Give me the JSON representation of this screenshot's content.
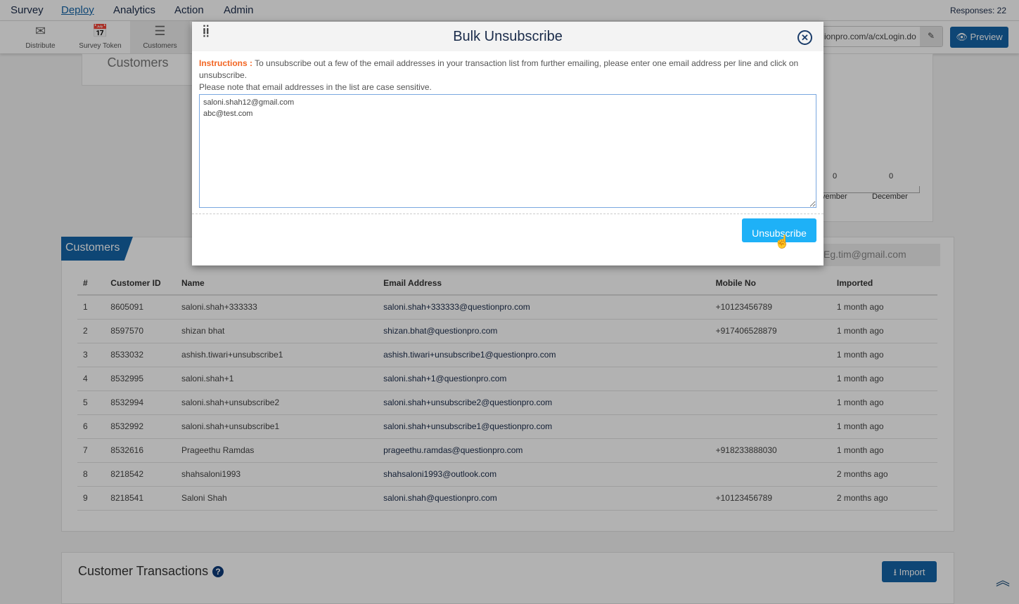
{
  "topnav": {
    "items": [
      "Survey",
      "Deploy",
      "Analytics",
      "Action",
      "Admin"
    ],
    "active": "Deploy",
    "responses": "Responses: 22"
  },
  "subnav": [
    {
      "label": "Distribute",
      "icon": "distribute-icon"
    },
    {
      "label": "Survey Token",
      "icon": "calendar-clock-icon"
    },
    {
      "label": "Customers",
      "icon": "customers-list-icon"
    }
  ],
  "url": "ionpro.com/a/cxLogin.do",
  "preview_label": "Preview",
  "customers_header": "Customers",
  "chart": {
    "values": [
      "0",
      "0"
    ],
    "labels": [
      "vember",
      "December"
    ]
  },
  "customers_tab": "Customers",
  "search_placeholder": "Eg.tim@gmail.com",
  "table": {
    "headers": [
      "#",
      "Customer ID",
      "Name",
      "Email Address",
      "Mobile No",
      "Imported"
    ],
    "rows": [
      [
        "1",
        "8605091",
        "saloni.shah+333333",
        "saloni.shah+333333@questionpro.com",
        "+10123456789",
        "1 month ago"
      ],
      [
        "2",
        "8597570",
        "shizan bhat",
        "shizan.bhat@questionpro.com",
        "+917406528879",
        "1 month ago"
      ],
      [
        "3",
        "8533032",
        "ashish.tiwari+unsubscribe1",
        "ashish.tiwari+unsubscribe1@questionpro.com",
        "",
        "1 month ago"
      ],
      [
        "4",
        "8532995",
        "saloni.shah+1",
        "saloni.shah+1@questionpro.com",
        "",
        "1 month ago"
      ],
      [
        "5",
        "8532994",
        "saloni.shah+unsubscribe2",
        "saloni.shah+unsubscribe2@questionpro.com",
        "",
        "1 month ago"
      ],
      [
        "6",
        "8532992",
        "saloni.shah+unsubscribe1",
        "saloni.shah+unsubscribe1@questionpro.com",
        "",
        "1 month ago"
      ],
      [
        "7",
        "8532616",
        "Prageethu Ramdas",
        "prageethu.ramdas@questionpro.com",
        "+918233888030",
        "1 month ago"
      ],
      [
        "8",
        "8218542",
        "shahsaloni1993",
        "shahsaloni1993@outlook.com",
        "",
        "2 months ago"
      ],
      [
        "9",
        "8218541",
        "Saloni Shah",
        "saloni.shah@questionpro.com",
        "+10123456789",
        "2 months ago"
      ]
    ]
  },
  "transactions": {
    "title": "Customer Transactions",
    "import_label": "Import"
  },
  "modal": {
    "title": "Bulk Unsubscribe",
    "instructions_label": "Instructions :",
    "instructions": " To unsubscribe out a few of the email addresses in your transaction list from further emailing, please enter one email address per line and click on unsubscribe.",
    "note": "Please note that email addresses in the list are case sensitive.",
    "emails": "saloni.shah12@gmail.com\nabc@test.com",
    "button": "Unsubscribe"
  }
}
